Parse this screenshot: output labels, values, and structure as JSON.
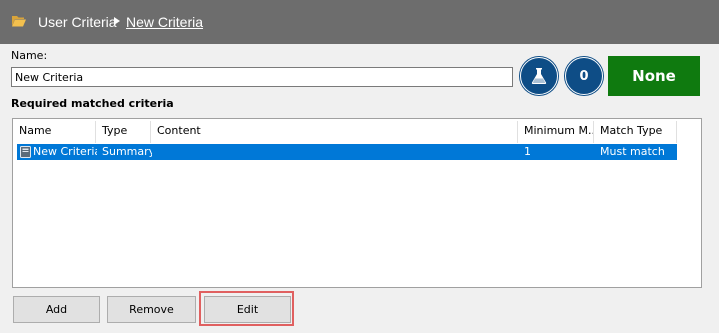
{
  "header": {
    "folder_icon": "open-folder-icon",
    "folder_color": "#f3c04e",
    "breadcrumb_root": "User Criteria",
    "breadcrumb_current": "New Criteria",
    "background": "#6d6d6d"
  },
  "form": {
    "name_label": "Name:",
    "name_value": "New Criteria"
  },
  "actions": {
    "test_icon": "flask-icon",
    "count": "0",
    "status_label": "None",
    "status_color": "#0f7a0f",
    "circle_color": "#0e4d86"
  },
  "criteria": {
    "title": "Required matched criteria",
    "columns": [
      "Name",
      "Type",
      "Content",
      "Minimum M...",
      "Match Type"
    ],
    "rows": [
      {
        "icon": "criteria-book-icon",
        "name": "New Criteria",
        "type": "Summary",
        "content": "",
        "minimum": "1",
        "match_type": "Must match",
        "selected": true
      }
    ],
    "selection_color": "#0078d7"
  },
  "buttons": {
    "add": "Add",
    "remove": "Remove",
    "edit": "Edit"
  }
}
